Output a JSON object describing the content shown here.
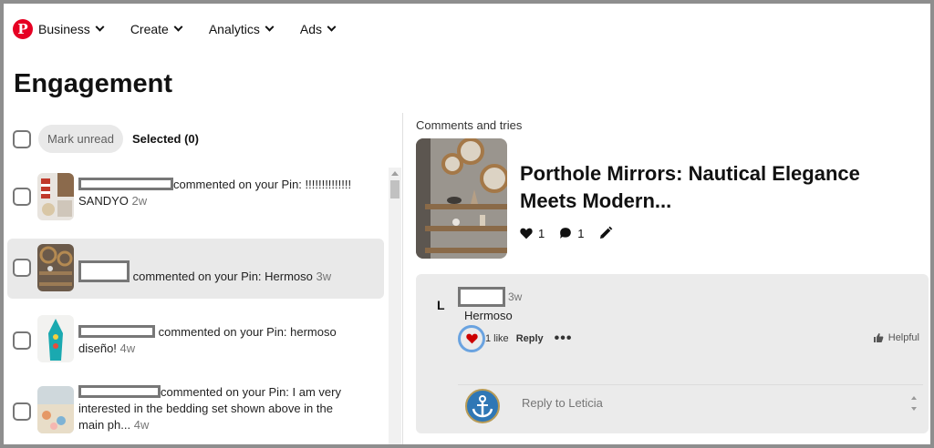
{
  "nav": {
    "logo": "P",
    "items": [
      {
        "label": "Business"
      },
      {
        "label": "Create"
      },
      {
        "label": "Analytics"
      },
      {
        "label": "Ads"
      }
    ]
  },
  "page": {
    "title": "Engagement"
  },
  "toolbar": {
    "mark_unread": "Mark unread",
    "selected": "Selected (0)"
  },
  "notifications": [
    {
      "text": "commented on your Pin: !!!!!!!!!!!!!!",
      "text2": "SANDYO",
      "ago": "2w",
      "selected": false
    },
    {
      "text": "commented on your Pin: Hermoso",
      "ago": "3w",
      "selected": true
    },
    {
      "text": "commented on your Pin: hermoso",
      "text2": "diseño!",
      "ago": "4w",
      "selected": false
    },
    {
      "text": "commented on your Pin: I am very",
      "text2": "interested in the bedding set shown above in the",
      "text3": "main ph...",
      "ago": "4w",
      "selected": false
    }
  ],
  "panel": {
    "section_label": "Comments and tries",
    "pin_title": "Porthole Mirrors: Nautical Elegance Meets Modern...",
    "likes": "1",
    "comments": "1"
  },
  "comment": {
    "initial": "L",
    "ago": "3w",
    "text": "Hermoso",
    "like_count": "1 like",
    "reply": "Reply",
    "more": "•••",
    "helpful": "Helpful"
  },
  "reply_box": {
    "placeholder": "Reply to Leticia"
  },
  "colors": {
    "brand": "#e60023",
    "selected_row": "#e9e9e9",
    "card": "#ebebeb",
    "focus_ring": "#6aa3e0"
  }
}
